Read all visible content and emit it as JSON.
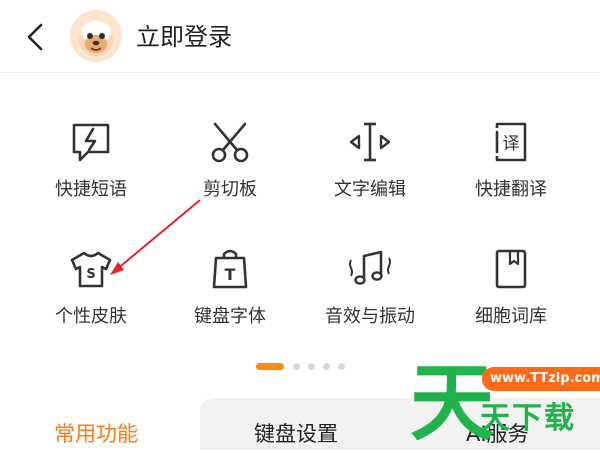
{
  "header": {
    "back_icon": "chevron-left-icon",
    "avatar_icon": "monkey-avatar-icon",
    "login_label": "立即登录"
  },
  "grid": {
    "row1": [
      {
        "label": "快捷短语",
        "icon": "lightning-speech-bubble-icon"
      },
      {
        "label": "剪切板",
        "icon": "scissors-icon"
      },
      {
        "label": "文字编辑",
        "icon": "text-cursor-arrows-icon"
      },
      {
        "label": "快捷翻译",
        "icon": "translate-icon"
      }
    ],
    "row2": [
      {
        "label": "个性皮肤",
        "icon": "tshirt-icon"
      },
      {
        "label": "键盘字体",
        "icon": "font-bag-icon"
      },
      {
        "label": "音效与振动",
        "icon": "music-vibration-icon"
      },
      {
        "label": "细胞词库",
        "icon": "book-icon"
      }
    ]
  },
  "pager": {
    "count": 5,
    "active_index": 0
  },
  "tabs": [
    {
      "label": "常用功能",
      "active": true
    },
    {
      "label": "键盘设置",
      "active": false
    },
    {
      "label": "AI服务",
      "active": false
    }
  ],
  "watermark": {
    "url": "www.TTzip.com",
    "big": "天",
    "small": "天下载"
  },
  "colors": {
    "accent": "#ff8a12",
    "annotation_arrow": "#e8202a",
    "watermark_green": "#22b24c"
  }
}
